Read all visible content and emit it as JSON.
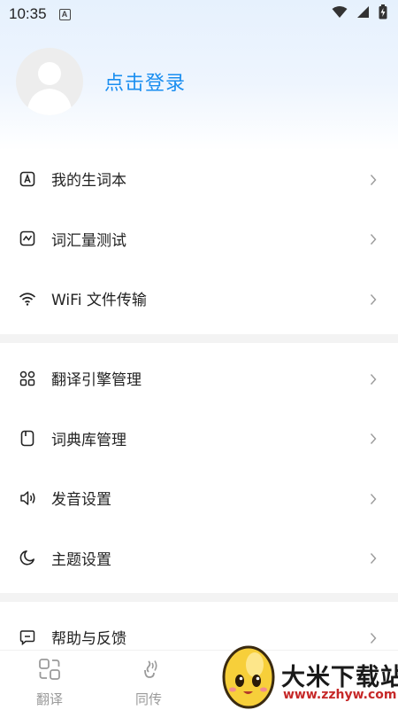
{
  "status_bar": {
    "time": "10:35",
    "notification_glyph": "A"
  },
  "profile": {
    "login_label": "点击登录"
  },
  "menu_group_1": [
    {
      "label": "我的生词本",
      "icon": "vocab-book-icon"
    },
    {
      "label": "词汇量测试",
      "icon": "chart-test-icon"
    },
    {
      "label": "WiFi 文件传输",
      "icon": "wifi-icon"
    }
  ],
  "menu_group_2": [
    {
      "label": "翻译引擎管理",
      "icon": "grid-apps-icon"
    },
    {
      "label": "词典库管理",
      "icon": "dictionary-icon"
    },
    {
      "label": "发音设置",
      "icon": "speaker-icon"
    },
    {
      "label": "主题设置",
      "icon": "moon-icon"
    }
  ],
  "menu_group_3": [
    {
      "label": "帮助与反馈",
      "icon": "feedback-icon"
    }
  ],
  "bottom_nav": [
    {
      "label": "翻译",
      "icon": "translate-icon"
    },
    {
      "label": "同传",
      "icon": "interpret-icon"
    }
  ],
  "watermark": {
    "title": "大米下载站",
    "url": "www.zzhyw.com"
  },
  "colors": {
    "accent": "#1a8ef0",
    "text": "#222222",
    "chevron": "#9a9a9a",
    "divider": "#f3f3f3"
  }
}
